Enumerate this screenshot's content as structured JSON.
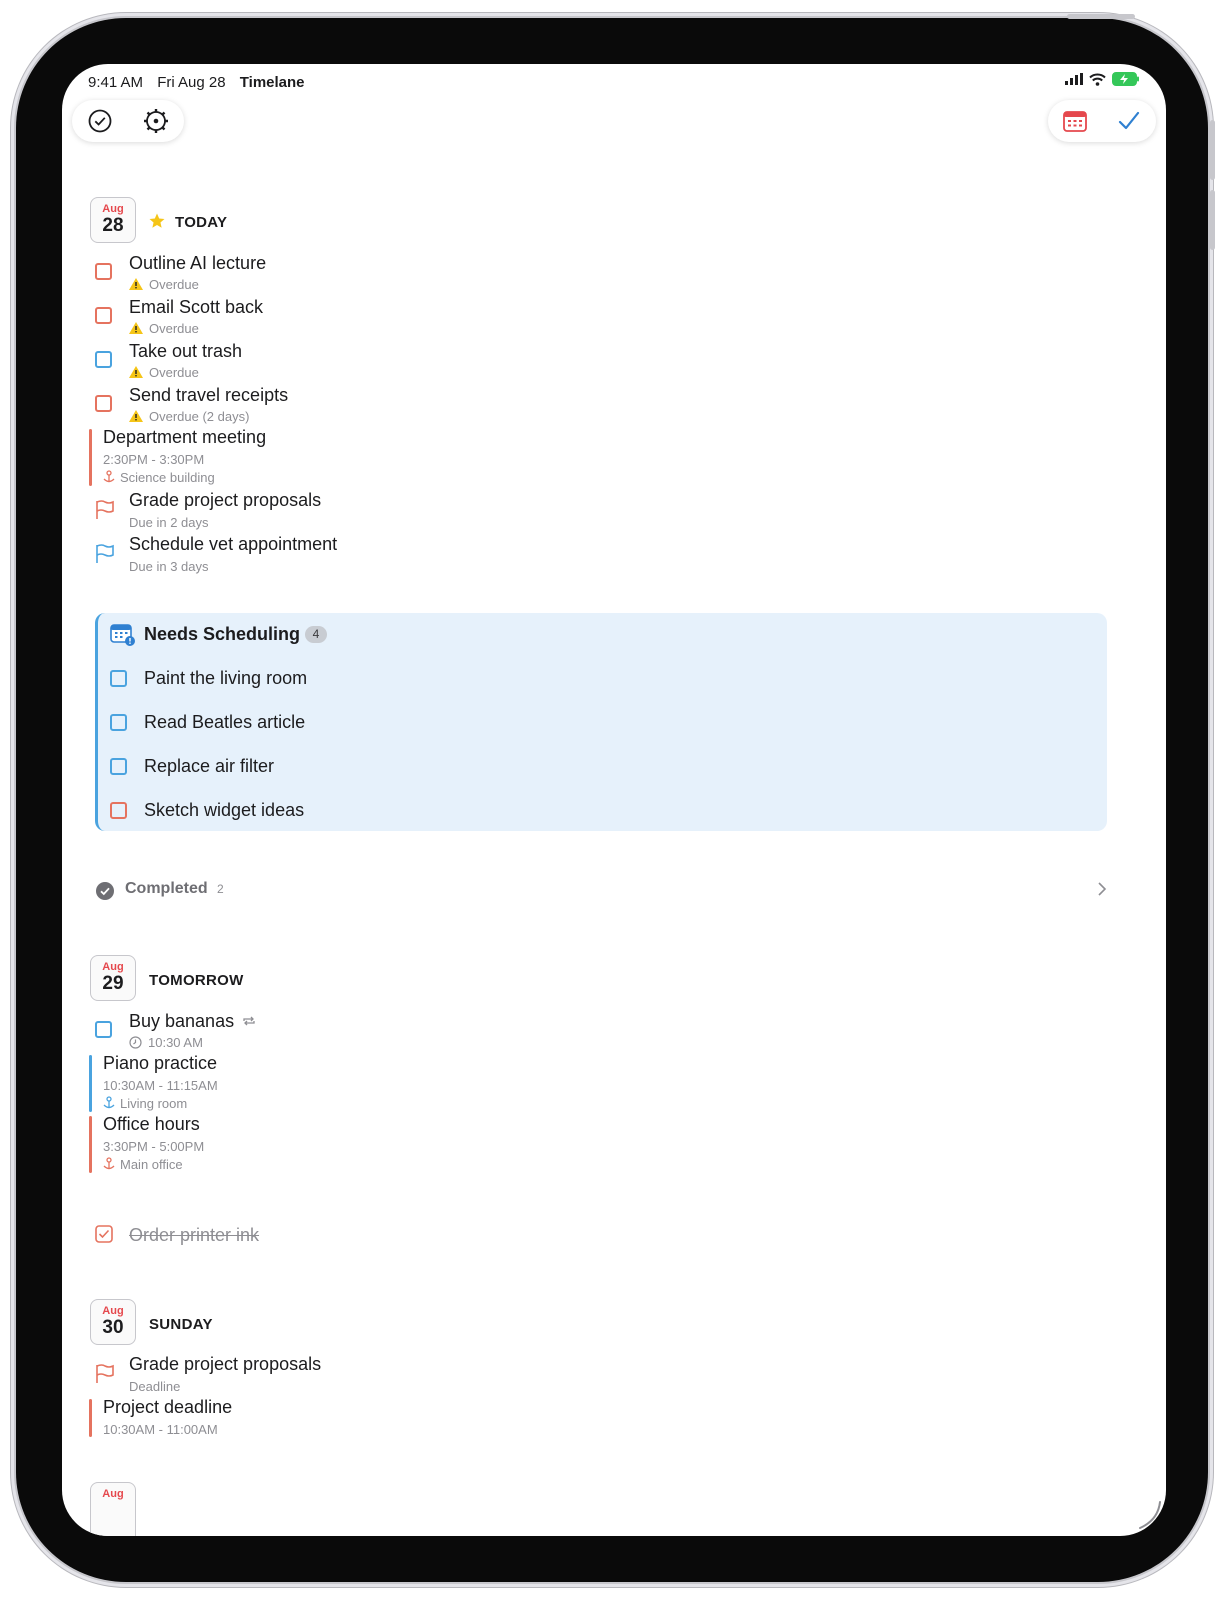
{
  "status": {
    "time": "9:41 AM",
    "date": "Fri Aug 28",
    "app": "Timelane"
  },
  "toolbar": {
    "left_icons": [
      "checkmark-circle-icon",
      "gear-icon"
    ],
    "right_icons": [
      "calendar-icon",
      "checkmark-icon"
    ],
    "colors": {
      "calendar": "#e5484d",
      "check": "#2f80d1"
    }
  },
  "today": {
    "month": "Aug",
    "day": "28",
    "title": "TODAY",
    "tasks": [
      {
        "title": "Outline AI lecture",
        "sub": "Overdue"
      },
      {
        "title": "Email Scott back",
        "sub": "Overdue"
      },
      {
        "title": "Take out trash",
        "sub": "Overdue"
      },
      {
        "title": "Send travel receipts",
        "sub": "Overdue (2 days)"
      }
    ],
    "event": {
      "title": "Department meeting",
      "time": "2:30PM - 3:30PM",
      "location": "Science building"
    },
    "deadlines": [
      {
        "title": "Grade project proposals",
        "sub": "Due in 2 days"
      },
      {
        "title": "Schedule vet appointment",
        "sub": "Due in 3 days"
      }
    ]
  },
  "needs_scheduling": {
    "title": "Needs Scheduling",
    "count": "4",
    "items": [
      "Paint the living room",
      "Read Beatles article",
      "Replace air filter",
      "Sketch widget ideas"
    ]
  },
  "completed": {
    "label": "Completed",
    "count": "2"
  },
  "tomorrow": {
    "month": "Aug",
    "day": "29",
    "title": "TOMORROW",
    "task": {
      "title": "Buy bananas",
      "time": "10:30 AM"
    },
    "events": [
      {
        "title": "Piano practice",
        "time": "10:30AM - 11:15AM",
        "location": "Living room"
      },
      {
        "title": "Office hours",
        "time": "3:30PM - 5:00PM",
        "location": "Main office"
      }
    ],
    "done_task": "Order printer ink"
  },
  "sunday": {
    "month": "Aug",
    "day": "30",
    "title": "SUNDAY",
    "deadline": {
      "title": "Grade project proposals",
      "sub": "Deadline"
    },
    "event": {
      "title": "Project deadline",
      "time": "10:30AM - 11:00AM"
    }
  },
  "next": {
    "month": "Aug"
  }
}
